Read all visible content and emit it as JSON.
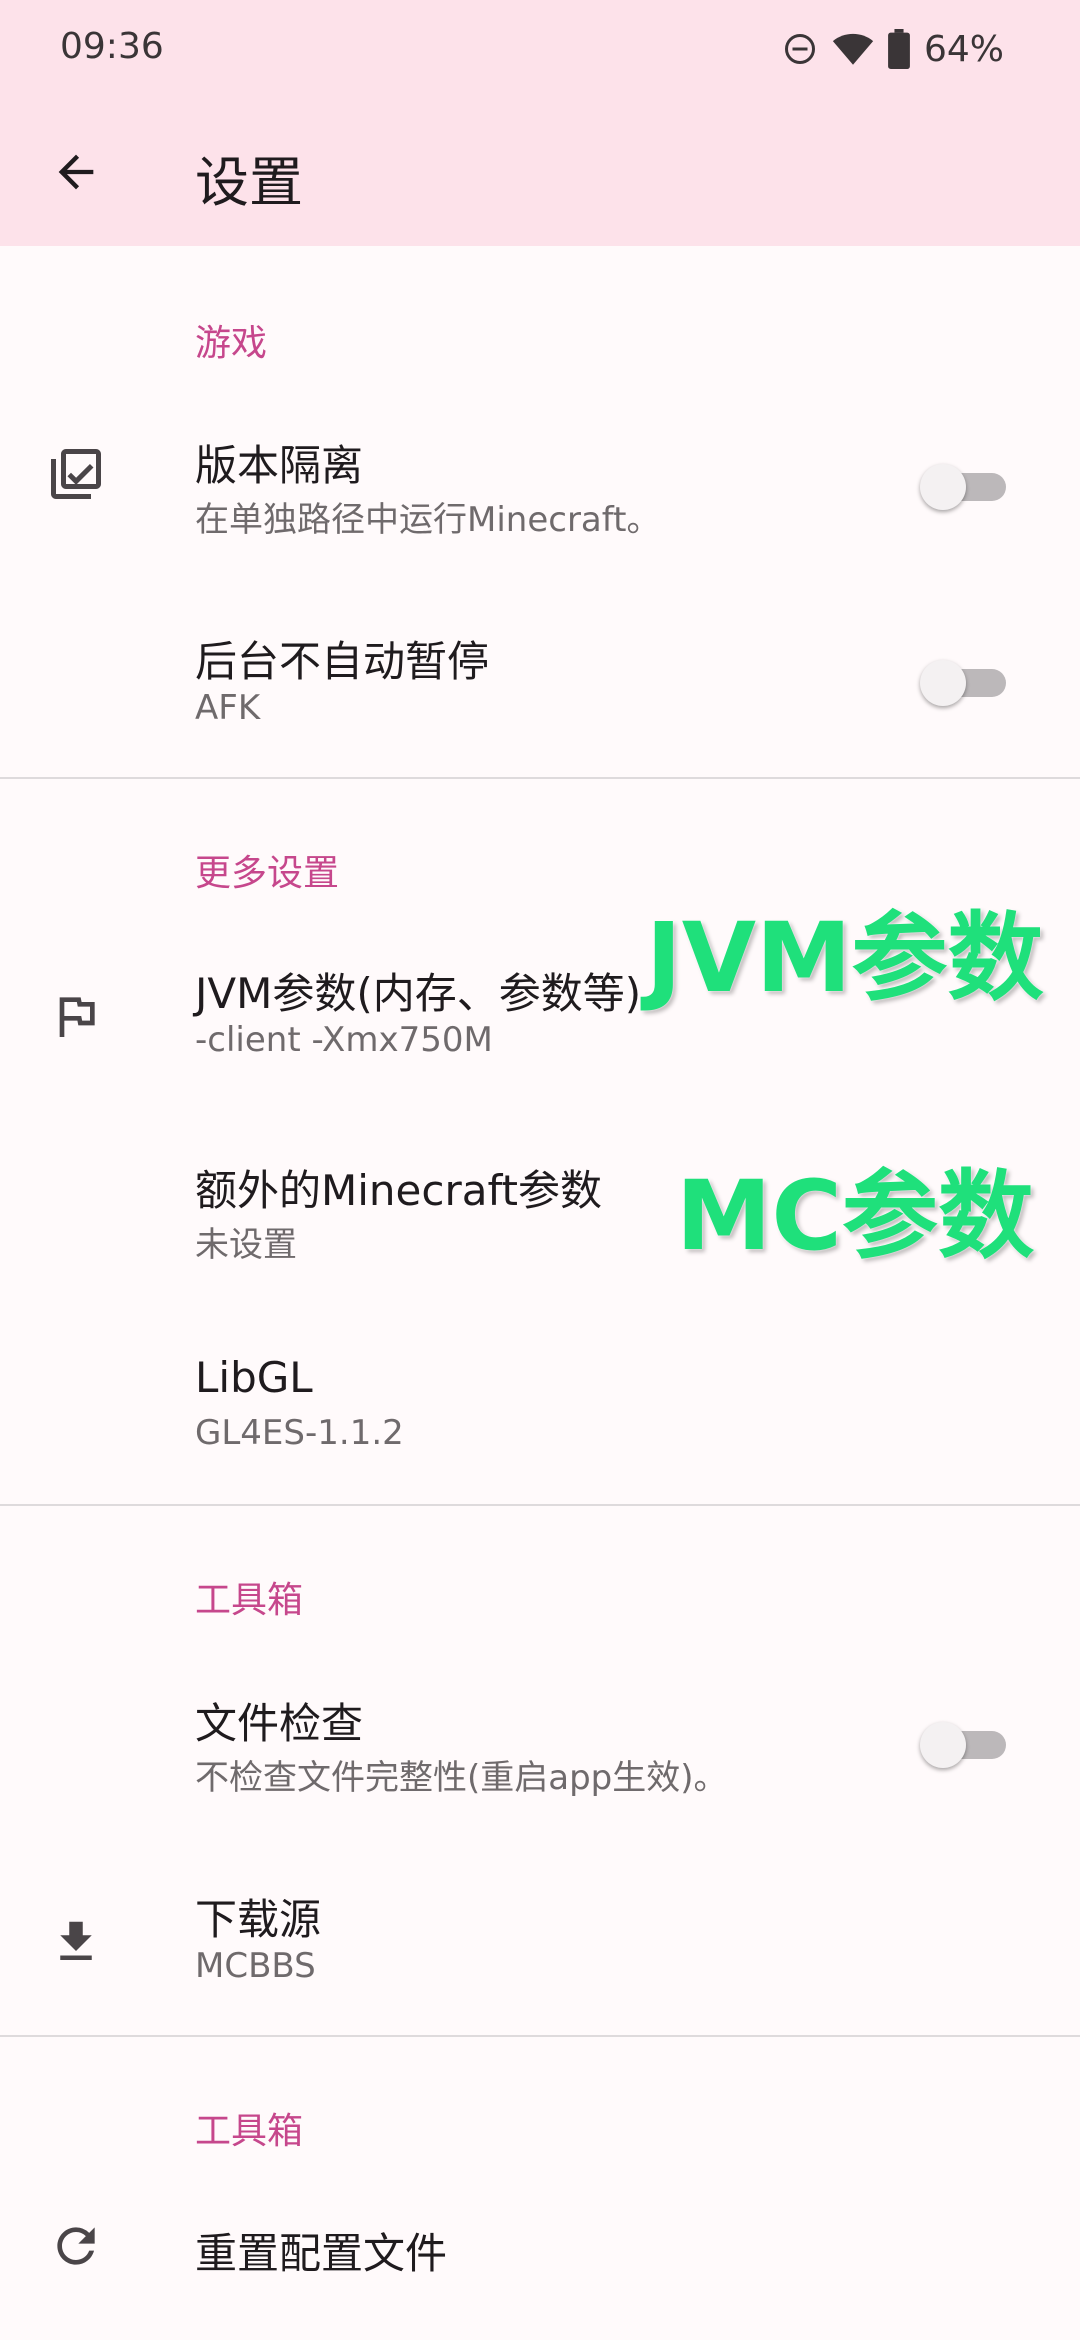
{
  "status_bar": {
    "time": "09:36",
    "battery": "64%",
    "icons": [
      "do-not-disturb-icon",
      "wifi-icon",
      "battery-icon"
    ]
  },
  "app_bar": {
    "title": "设置",
    "back_icon": "arrow-back-icon"
  },
  "colors": {
    "accent": "#c6478c",
    "app_bar_bg": "#fde2ea",
    "background": "#fffafb",
    "overlay_green": "#1fe07b"
  },
  "sections": [
    {
      "title": "游戏",
      "items": [
        {
          "title": "版本隔离",
          "summary": "在单独路径中运行Minecraft。",
          "icon": "library-check-icon",
          "switch": false
        },
        {
          "title": "后台不自动暂停",
          "summary": "AFK",
          "switch": false
        }
      ]
    },
    {
      "title": "更多设置",
      "items": [
        {
          "title": "JVM参数(内存、参数等)",
          "summary": "-client -Xmx750M",
          "icon": "flag-icon"
        },
        {
          "title": "额外的Minecraft参数",
          "summary": "未设置"
        },
        {
          "title": "LibGL",
          "summary": "GL4ES-1.1.2"
        }
      ]
    },
    {
      "title": "工具箱",
      "items": [
        {
          "title": "文件检查",
          "summary": "不检查文件完整性(重启app生效)。",
          "switch": false
        },
        {
          "title": "下载源",
          "summary": "MCBBS",
          "icon": "download-icon"
        }
      ]
    },
    {
      "title": "工具箱",
      "items": [
        {
          "title": "重置配置文件",
          "icon": "refresh-icon"
        }
      ]
    }
  ],
  "overlays": {
    "jvm_label": "JVM参数",
    "mc_label": "MC参数"
  }
}
